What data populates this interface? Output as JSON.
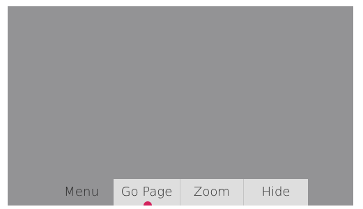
{
  "menu": {
    "label": "Menu",
    "items": [
      {
        "label": "Go Page"
      },
      {
        "label": "Zoom"
      },
      {
        "label": "Hide"
      }
    ]
  },
  "colors": {
    "screen_background": "#939395",
    "menu_background": "#dedede",
    "pointer": "#d2235c"
  },
  "icons": {
    "pointer": "selection-pointer-icon"
  }
}
